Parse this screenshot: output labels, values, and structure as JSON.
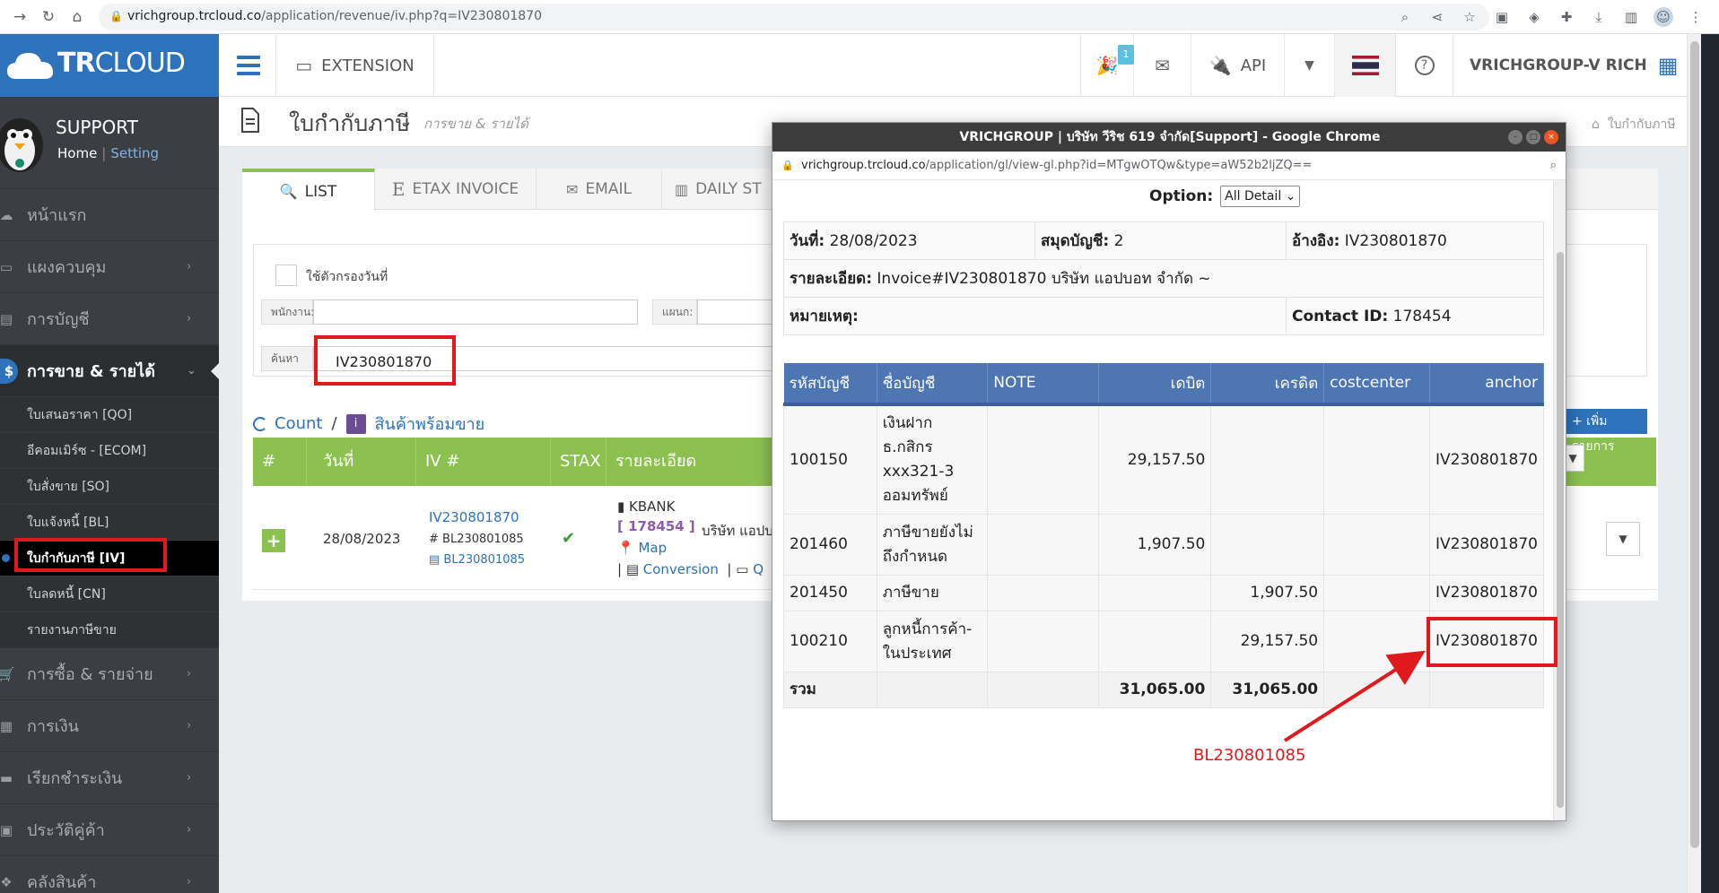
{
  "browser": {
    "url_host": "vrichgroup.trcloud.co",
    "url_path": "/application/revenue/iv.php?q=IV230801870"
  },
  "app": {
    "logo_bold": "TR",
    "logo_thin": "CLOUD",
    "top_extension": "EXTENSION",
    "top_api": "API",
    "notif_count": "1",
    "user": "VRICHGROUP-V RICH"
  },
  "sidebar": {
    "profile_name": "SUPPORT",
    "home": "Home",
    "setting": "Setting",
    "items": [
      {
        "label": "หน้าแรก"
      },
      {
        "label": "แผงควบคุม"
      },
      {
        "label": "การบัญชี"
      },
      {
        "label": "การขาย & รายได้"
      },
      {
        "label": "การซื้อ & รายจ่าย"
      },
      {
        "label": "การเงิน"
      },
      {
        "label": "เรียกชำระเงิน"
      },
      {
        "label": "ประวัติคู่ค้า"
      },
      {
        "label": "คลังสินค้า"
      }
    ],
    "sub": [
      {
        "label": "ใบเสนอราคา [QO]"
      },
      {
        "label": "อีคอมเมิร์ซ - [ECOM]"
      },
      {
        "label": "ใบสั่งขาย [SO]"
      },
      {
        "label": "ใบแจ้งหนี้ [BL]"
      },
      {
        "label": "ใบกำกับภาษี [IV]"
      },
      {
        "label": "ใบลดหนี้ [CN]"
      },
      {
        "label": "รายงานภาษีขาย"
      }
    ]
  },
  "page": {
    "title": "ใบกำกับภาษี",
    "subtitle": "การขาย & รายได้",
    "breadcrumb": "ใบกำกับภาษี",
    "tabs": [
      "LIST",
      "ETAX INVOICE",
      "EMAIL",
      "DAILY ST"
    ],
    "filter_date_label": "ใช้ตัวกรองวันที่",
    "employee_label": "พนักงาน:",
    "dept_label": "แผนก:",
    "search_label": "ค้นหา",
    "search_value": "IV230801870",
    "count_label": "Count",
    "slash": "/",
    "stock_label": "สินค้าพร้อมขาย",
    "add_item": "+ เพิ่มรายการ",
    "cols": [
      "#",
      "วันที่",
      "IV #",
      "STAX",
      "รายละเอียด"
    ],
    "row": {
      "date": "28/08/2023",
      "iv": "IV230801870",
      "bl_ref": "BL230801085",
      "bl_link": "BL230801085",
      "bank": "KBANK",
      "contact": "[ 178454 ]",
      "company": "บริษัท แอปบ",
      "map": "Map",
      "conversion": "Conversion",
      "q": "Q"
    }
  },
  "popup": {
    "title": "VRICHGROUP | บริษัท วีริช 619 จำกัด[Support] - Google Chrome",
    "url_host": "vrichgroup.trcloud.co",
    "url_path": "/application/gl/view-gl.php?id=MTgwOTQw&type=aW52b2ljZQ==",
    "option_label": "Option:",
    "option_value": "All Detail",
    "date_label": "วันที่:",
    "date_value": "28/08/2023",
    "journal_label": "สมุดบัญชี:",
    "journal_value": "2",
    "ref_label": "อ้างอิง:",
    "ref_value": "IV230801870",
    "detail_label": "รายละเอียด:",
    "detail_value": "Invoice#IV230801870 บริษัท แอปบอท จำกัด ~",
    "note_label": "หมายเหตุ:",
    "contact_label": "Contact ID:",
    "contact_value": "178454",
    "columns": [
      "รหัสบัญชี",
      "ชื่อบัญชี",
      "NOTE",
      "เดบิต",
      "เครดิต",
      "costcenter",
      "anchor"
    ],
    "rows": [
      {
        "code": "100150",
        "name": "เงินฝาก ธ.กสิกร xxx321-3 ออมทรัพย์",
        "note": "",
        "debit": "29,157.50",
        "credit": "",
        "cc": "",
        "anchor": "IV230801870"
      },
      {
        "code": "201460",
        "name": "ภาษีขายยังไม่ถึงกำหนด",
        "note": "",
        "debit": "1,907.50",
        "credit": "",
        "cc": "",
        "anchor": "IV230801870"
      },
      {
        "code": "201450",
        "name": "ภาษีขาย",
        "note": "",
        "debit": "",
        "credit": "1,907.50",
        "cc": "",
        "anchor": "IV230801870"
      },
      {
        "code": "100210",
        "name": "ลูกหนี้การค้า-ในประเทศ",
        "note": "",
        "debit": "",
        "credit": "29,157.50",
        "cc": "",
        "anchor": "IV230801870"
      }
    ],
    "total_label": "รวม",
    "total_debit": "31,065.00",
    "total_credit": "31,065.00"
  },
  "annotation": {
    "text": "BL230801085",
    "color": "#e0191f"
  }
}
